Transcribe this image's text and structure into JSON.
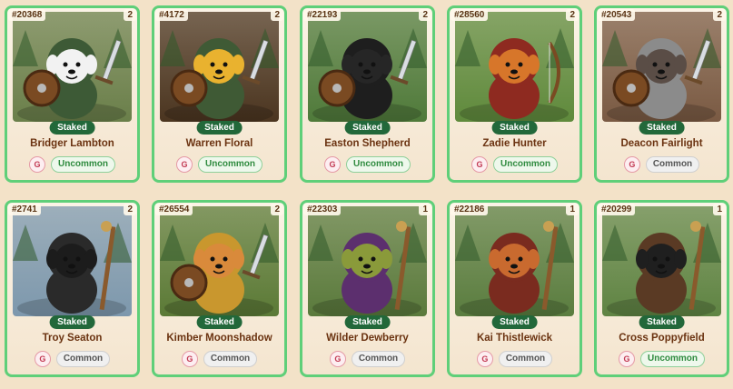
{
  "staked_label": "Staked",
  "grade_label": "G",
  "cards": [
    {
      "id": "#20368",
      "level": "2",
      "name": "Bridger Lambton",
      "rarity": "Uncommon",
      "rarity_class": "uncommon",
      "bg": "#6a7f4a",
      "fur": "#f2f2f2",
      "hood": "#3d5a36",
      "item": "sword-icon"
    },
    {
      "id": "#4172",
      "level": "2",
      "name": "Warren Floral",
      "rarity": "Uncommon",
      "rarity_class": "uncommon",
      "bg": "#4b3520",
      "fur": "#e9b22f",
      "hood": "#3f5a35",
      "item": "sword-icon"
    },
    {
      "id": "#22193",
      "level": "2",
      "name": "Easton Shepherd",
      "rarity": "Uncommon",
      "rarity_class": "uncommon",
      "bg": "#4f7a3a",
      "fur": "#262626",
      "hood": "#1e1e1e",
      "item": "sword-icon"
    },
    {
      "id": "#28560",
      "level": "2",
      "name": "Zadie Hunter",
      "rarity": "Uncommon",
      "rarity_class": "uncommon",
      "bg": "#5f8a3c",
      "fur": "#d7762a",
      "hood": "#8e2a20",
      "item": "bow-icon"
    },
    {
      "id": "#20543",
      "level": "2",
      "name": "Deacon Fairlight",
      "rarity": "Common",
      "rarity_class": "common",
      "bg": "#7a5a43",
      "fur": "#5a4d46",
      "hood": "#8b8b8b",
      "item": "sword-icon"
    },
    {
      "id": "#2741",
      "level": "2",
      "name": "Troy Seaton",
      "rarity": "Common",
      "rarity_class": "common",
      "bg": "#7d98ad",
      "fur": "#1c1c1c",
      "hood": "#2a2a2a",
      "item": "staff-icon"
    },
    {
      "id": "#26554",
      "level": "2",
      "name": "Kimber Moonshadow",
      "rarity": "Common",
      "rarity_class": "common",
      "bg": "#5b7a36",
      "fur": "#d98a3b",
      "hood": "#c9972e",
      "item": "sword-icon"
    },
    {
      "id": "#22303",
      "level": "1",
      "name": "Wilder Dewberry",
      "rarity": "Common",
      "rarity_class": "common",
      "bg": "#5a7a3c",
      "fur": "#8a9a3a",
      "hood": "#5c2f6e",
      "item": "staff-icon"
    },
    {
      "id": "#22186",
      "level": "1",
      "name": "Kai Thistlewick",
      "rarity": "Common",
      "rarity_class": "common",
      "bg": "#5a7d3f",
      "fur": "#c96a2f",
      "hood": "#7a2b1f",
      "item": "staff-icon"
    },
    {
      "id": "#20299",
      "level": "1",
      "name": "Cross Poppyfield",
      "rarity": "Uncommon",
      "rarity_class": "uncommon",
      "bg": "#5f8443",
      "fur": "#1f1f1f",
      "hood": "#5a3a24",
      "item": "staff-icon"
    }
  ]
}
